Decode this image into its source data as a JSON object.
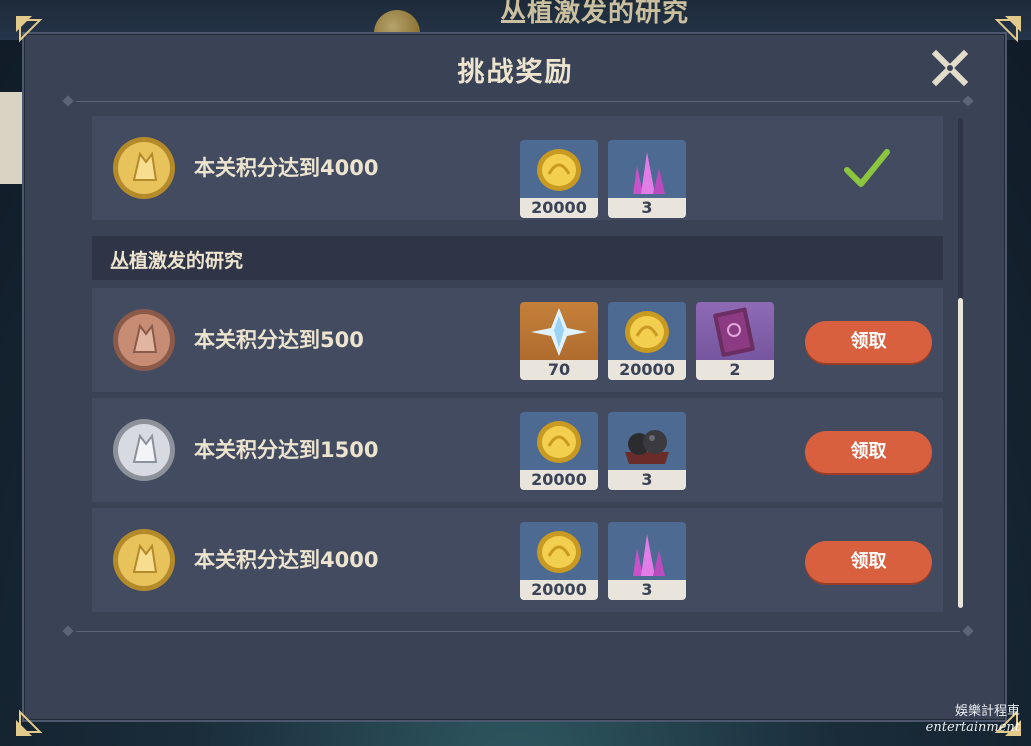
{
  "background": {
    "event_title": "丛植激发的研究"
  },
  "dialog": {
    "title": "挑战奖励"
  },
  "top_row": {
    "label": "本关积分达到4000",
    "medal": "gold",
    "rewards": [
      {
        "icon": "mora-coin-icon",
        "count": "20000"
      },
      {
        "icon": "crystal-icon",
        "count": "3"
      }
    ],
    "status": "claimed"
  },
  "section": {
    "title": "丛植激发的研究"
  },
  "rows": [
    {
      "label": "本关积分达到500",
      "medal": "bronze",
      "rewards": [
        {
          "icon": "primogem-icon",
          "count": "70"
        },
        {
          "icon": "mora-coin-icon",
          "count": "20000"
        },
        {
          "icon": "book-icon",
          "count": "2"
        }
      ],
      "button": "领取"
    },
    {
      "label": "本关积分达到1500",
      "medal": "silver",
      "rewards": [
        {
          "icon": "mora-coin-icon",
          "count": "20000"
        },
        {
          "icon": "iron-ore-icon",
          "count": "3"
        }
      ],
      "button": "领取"
    },
    {
      "label": "本关积分达到4000",
      "medal": "gold",
      "rewards": [
        {
          "icon": "mora-coin-icon",
          "count": "20000"
        },
        {
          "icon": "crystal-icon",
          "count": "3"
        }
      ],
      "button": "领取"
    }
  ],
  "colors": {
    "panel": "#3a4256",
    "row": "#424b60",
    "claim_button": "#d8603f",
    "check": "#8cc63f"
  },
  "watermark": {
    "line1": "娛樂計程車",
    "line2": "entertainment"
  }
}
